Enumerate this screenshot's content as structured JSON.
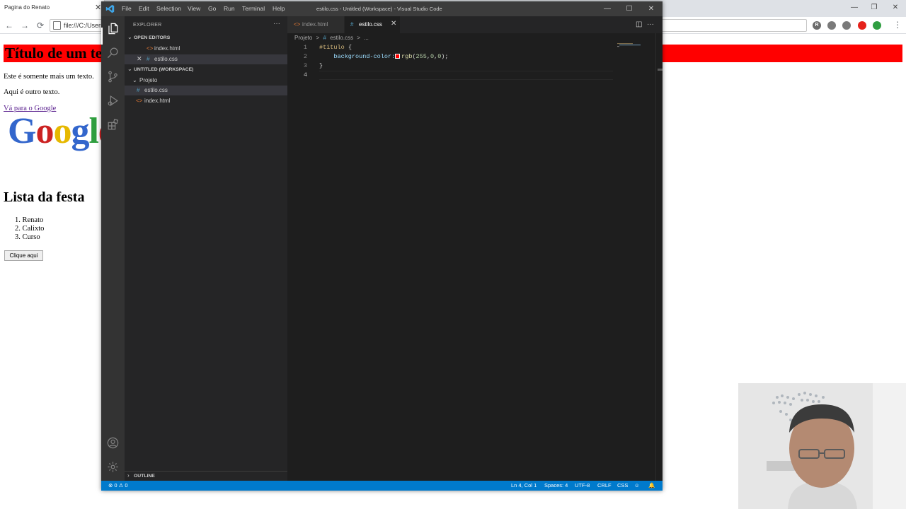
{
  "browser": {
    "tab_title": "Pagina do Renato",
    "tab_close": "✕",
    "url": "file:///C:/Users/",
    "window_controls": {
      "minimize": "—",
      "restore": "❐",
      "close": "✕"
    },
    "nav": {
      "back": "←",
      "forward": "→",
      "reload": "⟳"
    },
    "menu_icon": "⋮",
    "extensions": [
      {
        "icon": "r-extension-icon",
        "letter": "R",
        "color": "#6b6b6b"
      },
      {
        "icon": "puzzle-extension-icon",
        "letter": "",
        "color": "#7a7a7a"
      },
      {
        "icon": "grid-extension-icon",
        "letter": "",
        "color": "#7a7a7a"
      },
      {
        "icon": "opera-extension-icon",
        "letter": "",
        "color": "#e5211a"
      },
      {
        "icon": "download-extension-icon",
        "letter": "",
        "color": "#2f9e41"
      }
    ]
  },
  "page": {
    "title": "Título de um texto",
    "title_bg": "#ff0000",
    "paragraph_1": "Este é somente mais um texto.",
    "paragraph_2": "Aqui é outro texto.",
    "link": "Vá para o Google",
    "logo_text": "Google",
    "heading_2": "Lista da festa",
    "list": [
      "Renato",
      "Calixto",
      "Curso"
    ],
    "button": "Clique aqui"
  },
  "vscode": {
    "window_title": "estilo.css - Untitled (Workspace) - Visual Studio Code",
    "menu": [
      "File",
      "Edit",
      "Selection",
      "View",
      "Go",
      "Run",
      "Terminal",
      "Help"
    ],
    "window_controls": {
      "minimize": "—",
      "maximize": "☐",
      "close": "✕"
    },
    "activity_bar": [
      "explorer-icon",
      "search-icon",
      "source-control-icon",
      "run-debug-icon",
      "extensions-icon",
      "account-icon",
      "settings-gear-icon"
    ],
    "sidebar": {
      "header": "EXPLORER",
      "more": "···",
      "open_editors_label": "OPEN EDITORS",
      "open_editors": [
        {
          "name": "index.html",
          "icon": "<>",
          "type": "html"
        },
        {
          "name": "estilo.css",
          "icon": "#",
          "type": "css",
          "close": "✕"
        }
      ],
      "workspace_label": "UNTITLED (WORKSPACE)",
      "folder": "Projeto",
      "files": [
        {
          "name": "estilo.css",
          "icon": "#",
          "type": "css"
        },
        {
          "name": "index.html",
          "icon": "<>",
          "type": "html"
        }
      ],
      "outline_label": "OUTLINE",
      "chevron_down": "⌄",
      "chevron_right": "›"
    },
    "tabs": [
      {
        "name": "index.html",
        "icon": "<>",
        "active": false
      },
      {
        "name": "estilo.css",
        "icon": "#",
        "active": true,
        "close": "✕"
      }
    ],
    "tab_actions": {
      "split": "◫",
      "more": "···"
    },
    "breadcrumb": [
      "Projeto",
      ">",
      "#",
      "estilo.css",
      ">",
      "..."
    ],
    "code": {
      "line_numbers": [
        "1",
        "2",
        "3",
        "4"
      ],
      "line1_selector": "#titulo",
      "line1_brace": " {",
      "line2_indent": "    ",
      "line2_property": "background-color:",
      "line2_fn": "rgb",
      "line2_open": "(",
      "line2_num1": "255",
      "line2_comma1": ",",
      "line2_num2": "0",
      "line2_comma2": ",",
      "line2_num3": "0",
      "line2_close": ");",
      "line3": "}",
      "swatch_color": "#ff0000"
    },
    "status": {
      "problems": "⊗ 0 ⚠ 0",
      "position": "Ln 4, Col 1",
      "spaces": "Spaces: 4",
      "encoding": "UTF-8",
      "eol": "CRLF",
      "language": "CSS",
      "feedback_icon": "☺",
      "bell_icon": "🔔"
    }
  },
  "colors": {
    "vscode_bg": "#1e1e1e",
    "sidebar_bg": "#252526",
    "activity_bg": "#333333",
    "statusbar_bg": "#007acc",
    "titlebar_bg": "#3c3c3c",
    "selected_row": "#37373d"
  }
}
